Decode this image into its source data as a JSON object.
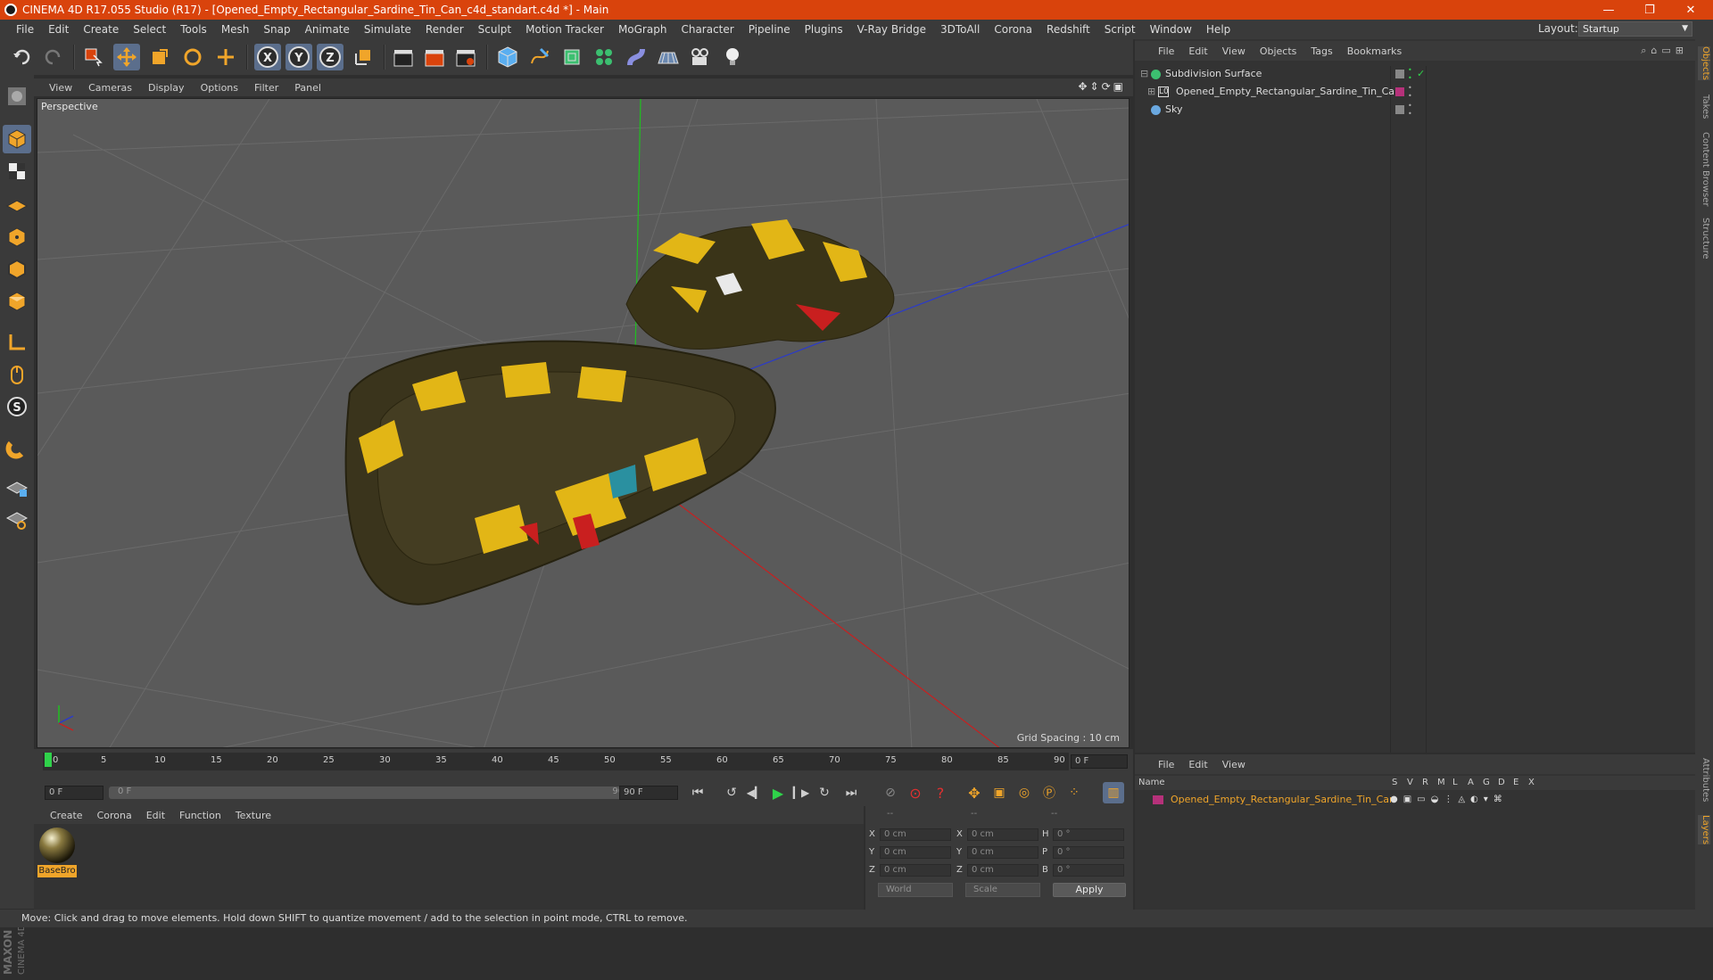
{
  "window": {
    "title": "CINEMA 4D R17.055 Studio (R17) - [Opened_Empty_Rectangular_Sardine_Tin_Can_c4d_standart.c4d *] - Main"
  },
  "menubar": [
    "File",
    "Edit",
    "Create",
    "Select",
    "Tools",
    "Mesh",
    "Snap",
    "Animate",
    "Simulate",
    "Render",
    "Sculpt",
    "Motion Tracker",
    "MoGraph",
    "Character",
    "Pipeline",
    "Plugins",
    "V-Ray Bridge",
    "3DToAll",
    "Corona",
    "Redshift",
    "Script",
    "Window",
    "Help"
  ],
  "layout": {
    "label": "Layout:",
    "value": "Startup"
  },
  "viewport": {
    "menu": [
      "View",
      "Cameras",
      "Display",
      "Options",
      "Filter",
      "Panel"
    ],
    "label": "Perspective",
    "grid_spacing": "Grid Spacing : 10 cm"
  },
  "timeline": {
    "ticks": [
      "0",
      "5",
      "10",
      "15",
      "20",
      "25",
      "30",
      "35",
      "40",
      "45",
      "50",
      "55",
      "60",
      "65",
      "70",
      "75",
      "80",
      "85",
      "90"
    ],
    "current_frame": "0 F",
    "start_field": "0 F",
    "range_start": "0 F",
    "range_end": "90 F",
    "end_field": "90 F"
  },
  "materials": {
    "menu": [
      "Create",
      "Corona",
      "Edit",
      "Function",
      "Texture"
    ],
    "items": [
      {
        "name": "BaseBro"
      }
    ]
  },
  "coords": {
    "headers": [
      "--",
      "--",
      "--"
    ],
    "rows": [
      {
        "a": "X",
        "av": "0 cm",
        "b": "X",
        "bv": "0 cm",
        "c": "H",
        "cv": "0 °"
      },
      {
        "a": "Y",
        "av": "0 cm",
        "b": "Y",
        "bv": "0 cm",
        "c": "P",
        "cv": "0 °"
      },
      {
        "a": "Z",
        "av": "0 cm",
        "b": "Z",
        "bv": "0 cm",
        "c": "B",
        "cv": "0 °"
      }
    ],
    "space": "World",
    "mode": "Scale",
    "apply": "Apply"
  },
  "objects": {
    "menu": [
      "File",
      "Edit",
      "View",
      "Objects",
      "Tags",
      "Bookmarks"
    ],
    "items": [
      {
        "name": "Subdivision Surface"
      },
      {
        "name": "Opened_Empty_Rectangular_Sardine_Tin_Can"
      },
      {
        "name": "Sky"
      }
    ]
  },
  "layers": {
    "menu": [
      "File",
      "Edit",
      "View"
    ],
    "header": {
      "name": "Name",
      "cols": [
        "S",
        "V",
        "R",
        "M",
        "L",
        "A",
        "G",
        "D",
        "E",
        "X"
      ]
    },
    "items": [
      {
        "name": "Opened_Empty_Rectangular_Sardine_Tin_Can"
      }
    ]
  },
  "right_tabs": [
    "Objects",
    "Takes",
    "Content Browser",
    "Structure",
    "Attributes",
    "Layers"
  ],
  "branding": {
    "line1": "MAXON",
    "line2": "CINEMA 4D"
  },
  "status": "Move: Click and drag to move elements. Hold down SHIFT to quantize movement / add to the selection in point mode, CTRL to remove.",
  "colors": {
    "accent_orange": "#d9430c",
    "highlight": "#f0a52a",
    "layer_magenta": "#b6317a",
    "active_blue": "#5b6e8c"
  }
}
